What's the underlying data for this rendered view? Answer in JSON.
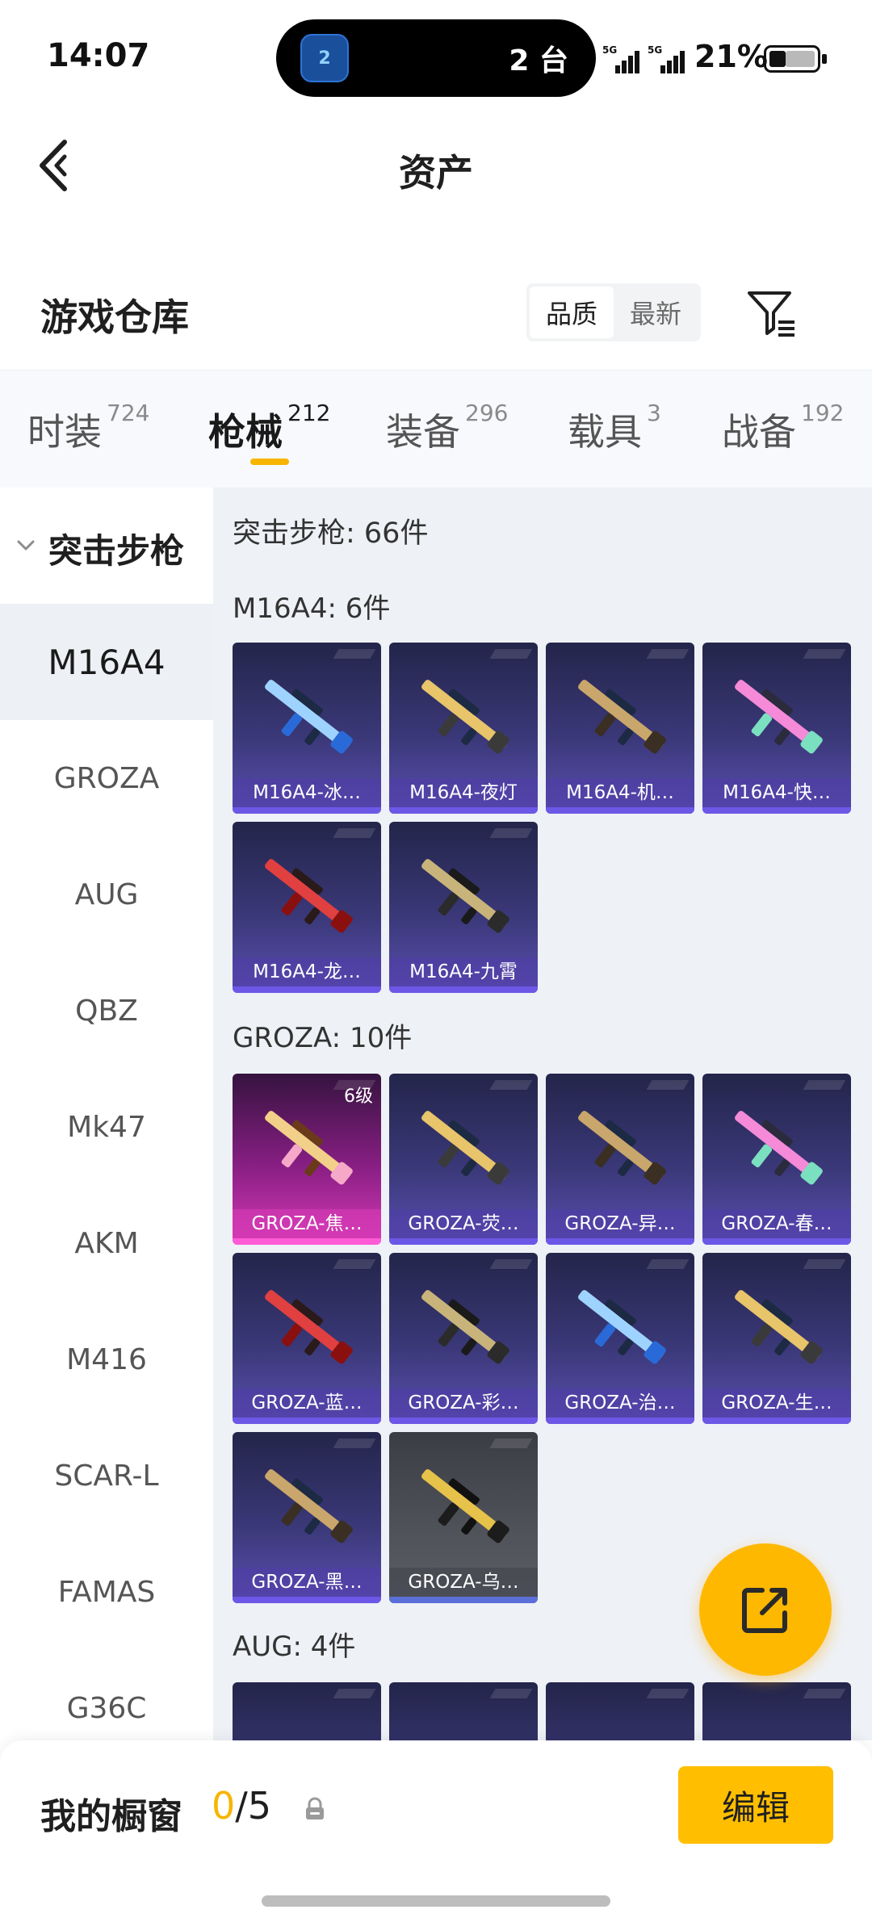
{
  "status_bar": {
    "time": "14:07",
    "island_app_badge": "2",
    "island_text": "2 台",
    "sim1_label": "5G",
    "sim2_label": "5G",
    "battery_pct": "21%"
  },
  "header": {
    "title": "资产"
  },
  "warehouse": {
    "title": "游戏仓库",
    "sort_options": [
      "品质",
      "最新"
    ],
    "sort_selected": "品质"
  },
  "tabs": [
    {
      "label": "时装",
      "count": "724"
    },
    {
      "label": "枪械",
      "count": "212"
    },
    {
      "label": "装备",
      "count": "296"
    },
    {
      "label": "载具",
      "count": "3"
    },
    {
      "label": "战备",
      "count": "192"
    }
  ],
  "active_tab": "枪械",
  "sidebar": {
    "category": "突击步枪",
    "items": [
      "M16A4",
      "GROZA",
      "AUG",
      "QBZ",
      "Mk47",
      "AKM",
      "M416",
      "SCAR-L",
      "FAMAS",
      "G36C"
    ],
    "selected": "M16A4"
  },
  "content": {
    "summary": "突击步枪: 66件",
    "groups": [
      {
        "header": "M16A4: 6件",
        "items": [
          {
            "label": "M16A4-冰…",
            "style": "purple"
          },
          {
            "label": "M16A4-夜灯",
            "style": "purple"
          },
          {
            "label": "M16A4-机…",
            "style": "purple"
          },
          {
            "label": "M16A4-快…",
            "style": "purple"
          },
          {
            "label": "M16A4-龙…",
            "style": "purple"
          },
          {
            "label": "M16A4-九霄",
            "style": "purple"
          }
        ]
      },
      {
        "header": "GROZA: 10件",
        "items": [
          {
            "label": "GROZA-焦…",
            "style": "gold",
            "level": "6级"
          },
          {
            "label": "GROZA-荧…",
            "style": "purple"
          },
          {
            "label": "GROZA-异…",
            "style": "purple"
          },
          {
            "label": "GROZA-春…",
            "style": "purple"
          },
          {
            "label": "GROZA-蓝…",
            "style": "purple"
          },
          {
            "label": "GROZA-彩…",
            "style": "purple"
          },
          {
            "label": "GROZA-治…",
            "style": "purple"
          },
          {
            "label": "GROZA-生…",
            "style": "purple"
          },
          {
            "label": "GROZA-黑…",
            "style": "purple"
          },
          {
            "label": "GROZA-乌…",
            "style": "grey"
          }
        ]
      },
      {
        "header": "AUG: 4件",
        "items": []
      }
    ]
  },
  "showcase": {
    "title": "我的橱窗",
    "count_used": "0",
    "count_total": "/5",
    "edit_label": "编辑"
  },
  "colors": {
    "accent": "#ffbe00",
    "card_purple": "#3a3878",
    "card_gold": "#d63ab6"
  }
}
